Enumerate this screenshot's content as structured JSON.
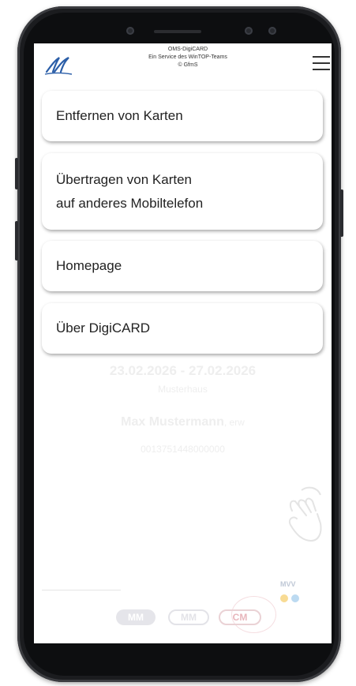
{
  "header": {
    "line1": "OMS-DigiCARD",
    "line2": "Ein Service des WinTOP-Teams",
    "line3": "© GfmS"
  },
  "menu": {
    "items": [
      {
        "label": "Entfernen von Karten"
      },
      {
        "label_line1": "Übertragen von Karten",
        "label_line2": "auf anderes Mobiltelefon"
      },
      {
        "label": "Homepage"
      },
      {
        "label": "Über DigiCARD"
      }
    ]
  },
  "card": {
    "date_range": "23.02.2026 - 27.02.2026",
    "location": "Musterhaus",
    "name": "Max Mustermann",
    "name_suffix": ", erw",
    "card_number": "0013751448000000"
  },
  "footer": {
    "badges": [
      "MM",
      "MM",
      "CM"
    ],
    "mvv": "MVV"
  },
  "colors": {
    "logo_blue": "#2b5ea8",
    "mvv_yellow": "#f3c34d",
    "mvv_blue": "#8fc2e8"
  }
}
